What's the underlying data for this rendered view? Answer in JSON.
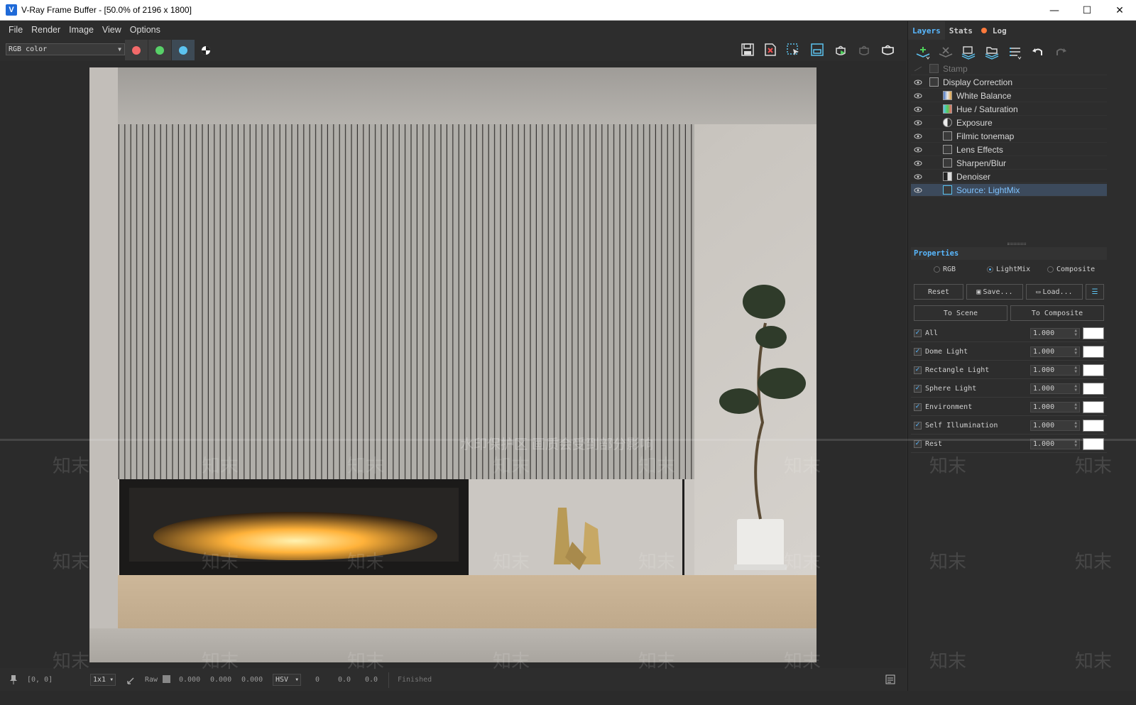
{
  "window": {
    "title": "V-Ray Frame Buffer - [50.0% of 2196 x 1800]",
    "app_icon_glyph": "V",
    "controls": {
      "minimize": "—",
      "maximize": "☐",
      "close": "✕"
    }
  },
  "menu": [
    "File",
    "Render",
    "Image",
    "View",
    "Options"
  ],
  "toolbar": {
    "channel": "RGB color",
    "channel_buttons": [
      {
        "name": "red-channel",
        "color": "#f36a6a"
      },
      {
        "name": "green-channel",
        "color": "#58d068"
      },
      {
        "name": "blue-channel",
        "color": "#5cc3f0"
      }
    ],
    "right_icons": [
      "save-icon",
      "clear-icon",
      "region-icon",
      "crop-icon",
      "render-icon",
      "interactive-icon",
      "teapot-icon"
    ]
  },
  "status": {
    "coords": "[0, 0]",
    "zoom": "1x1",
    "raw_label": "Raw",
    "raw_values": [
      "0.000",
      "0.000",
      "0.000"
    ],
    "color_mode": "HSV",
    "hsv_values": [
      "0",
      "0.0",
      "0.0"
    ],
    "state": "Finished"
  },
  "panel": {
    "tabs": [
      "Layers",
      "Stats",
      "Log"
    ],
    "active_tab": "Layers",
    "layer_tools": [
      "add-layer-icon",
      "delete-layer-icon",
      "save-layer-tree-icon",
      "load-layer-tree-icon",
      "layer-presets-icon",
      "undo-icon",
      "redo-icon"
    ],
    "layers": [
      {
        "label": "Stamp",
        "indent": 0,
        "dim": true,
        "selected": false
      },
      {
        "label": "Display Correction",
        "indent": 0,
        "dim": false,
        "selected": false
      },
      {
        "label": "White Balance",
        "indent": 1,
        "dim": false,
        "selected": false
      },
      {
        "label": "Hue / Saturation",
        "indent": 1,
        "dim": false,
        "selected": false
      },
      {
        "label": "Exposure",
        "indent": 1,
        "dim": false,
        "selected": false
      },
      {
        "label": "Filmic tonemap",
        "indent": 1,
        "dim": false,
        "selected": false
      },
      {
        "label": "Lens Effects",
        "indent": 1,
        "dim": false,
        "selected": false
      },
      {
        "label": "Sharpen/Blur",
        "indent": 1,
        "dim": false,
        "selected": false
      },
      {
        "label": "Denoiser",
        "indent": 1,
        "dim": false,
        "selected": false
      },
      {
        "label": "Source: LightMix",
        "indent": 1,
        "dim": false,
        "selected": true
      }
    ],
    "properties": {
      "title": "Properties",
      "modes": [
        "RGB",
        "LightMix",
        "Composite"
      ],
      "selected_mode": "LightMix",
      "buttons": {
        "reset": "Reset",
        "save": "Save...",
        "load": "Load...",
        "to_scene": "To Scene",
        "to_composite": "To Composite"
      },
      "lights": [
        {
          "name": "All",
          "value": "1.000",
          "checked": true
        },
        {
          "name": "Dome Light",
          "value": "1.000",
          "checked": true
        },
        {
          "name": "Rectangle Light",
          "value": "1.000",
          "checked": true
        },
        {
          "name": "Sphere Light",
          "value": "1.000",
          "checked": true
        },
        {
          "name": "Environment",
          "value": "1.000",
          "checked": true
        },
        {
          "name": "Self Illumination",
          "value": "1.000",
          "checked": true
        },
        {
          "name": "Rest",
          "value": "1.000",
          "checked": true
        }
      ]
    }
  },
  "watermark": {
    "banner": "水印保护区  画质会受到部分影响",
    "repeat": "知末"
  }
}
